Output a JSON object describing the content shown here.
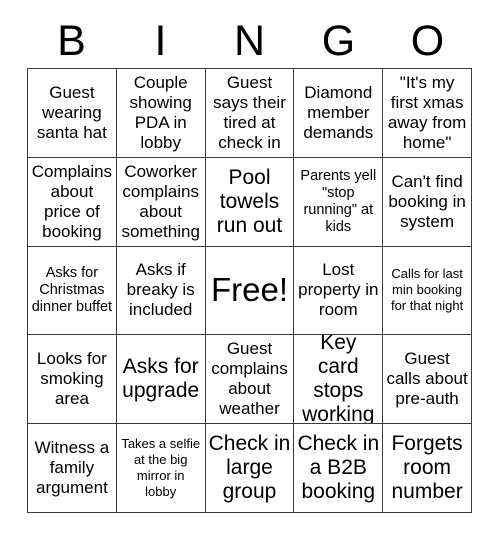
{
  "card": {
    "title": "BINGO Card",
    "background_color": "#ffffff",
    "text_color": "#000000",
    "border_color": "#3b3b3b"
  },
  "header": {
    "letters": [
      "B",
      "I",
      "N",
      "G",
      "O"
    ]
  },
  "grid": {
    "columns": 5,
    "rows": 5,
    "free_space_index": 12,
    "cells": [
      {
        "text": "Guest wearing santa hat",
        "size": "m"
      },
      {
        "text": "Couple showing PDA in lobby",
        "size": "m"
      },
      {
        "text": "Guest says their tired at check in",
        "size": "m"
      },
      {
        "text": "Diamond member demands",
        "size": "m"
      },
      {
        "text": "\"It's my first xmas away from home\"",
        "size": "m"
      },
      {
        "text": "Complains about price of booking",
        "size": "m"
      },
      {
        "text": "Coworker complains about something",
        "size": "m"
      },
      {
        "text": "Pool towels run out",
        "size": "l"
      },
      {
        "text": "Parents yell \"stop running\" at kids",
        "size": "s"
      },
      {
        "text": "Can't find booking in system",
        "size": "m"
      },
      {
        "text": "Asks for Christmas dinner buffet",
        "size": "s"
      },
      {
        "text": "Asks if breaky is included",
        "size": "m"
      },
      {
        "text": "Free!",
        "size": "free"
      },
      {
        "text": "Lost property in room",
        "size": "m"
      },
      {
        "text": "Calls for last min booking for that night",
        "size": "xs"
      },
      {
        "text": "Looks for smoking area",
        "size": "m"
      },
      {
        "text": "Asks for upgrade",
        "size": "l"
      },
      {
        "text": "Guest complains about weather",
        "size": "m"
      },
      {
        "text": "Key card stops working",
        "size": "l"
      },
      {
        "text": "Guest calls about pre-auth",
        "size": "m"
      },
      {
        "text": "Witness a family argument",
        "size": "m"
      },
      {
        "text": "Takes a selfie at the big mirror in lobby",
        "size": "xs"
      },
      {
        "text": "Check in large group",
        "size": "l"
      },
      {
        "text": "Check in a B2B booking",
        "size": "l"
      },
      {
        "text": "Forgets room number",
        "size": "l"
      }
    ]
  }
}
